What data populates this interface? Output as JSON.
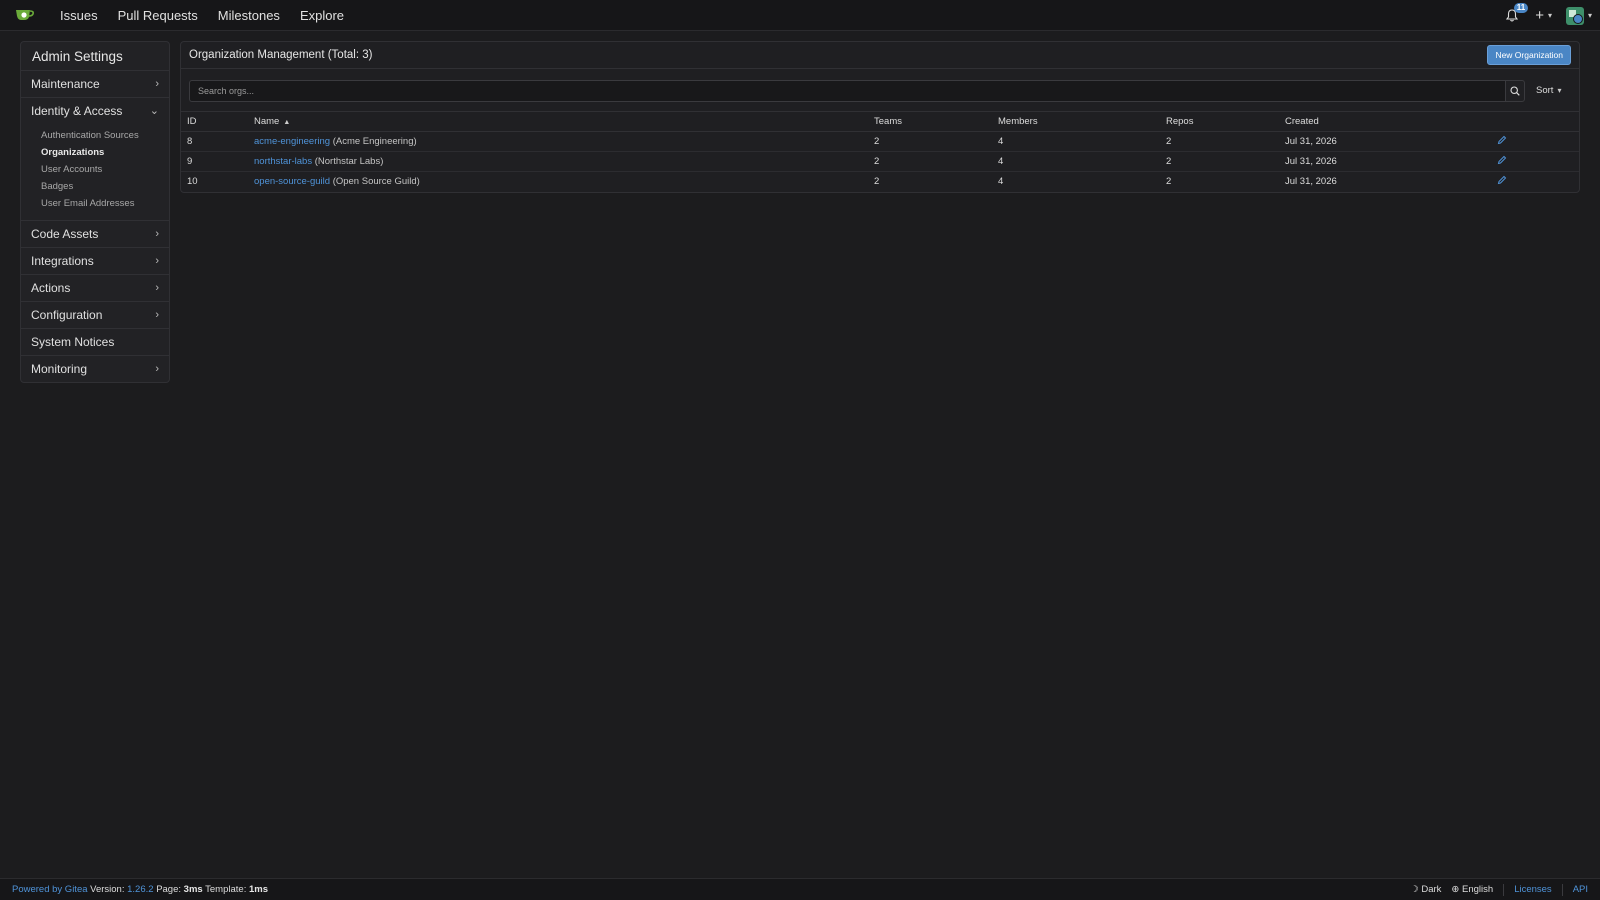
{
  "topnav": {
    "links": [
      "Issues",
      "Pull Requests",
      "Milestones",
      "Explore"
    ],
    "notifications_count": "11",
    "plus_symbol": "+"
  },
  "sidebar": {
    "title": "Admin Settings",
    "items": [
      {
        "label": "Maintenance",
        "expanded": false
      },
      {
        "label": "Identity & Access",
        "expanded": true,
        "subitems": [
          "Authentication Sources",
          "Organizations",
          "User Accounts",
          "Badges",
          "User Email Addresses"
        ],
        "active_subitem": "Organizations"
      },
      {
        "label": "Code Assets",
        "expanded": false
      },
      {
        "label": "Integrations",
        "expanded": false
      },
      {
        "label": "Actions",
        "expanded": false
      },
      {
        "label": "Configuration",
        "expanded": false
      },
      {
        "label": "System Notices"
      },
      {
        "label": "Monitoring",
        "expanded": false
      }
    ]
  },
  "main": {
    "title": "Organization Management (Total: 3)",
    "new_button": "New Organization",
    "search_placeholder": "Search orgs...",
    "sort_label": "Sort",
    "table": {
      "headers": [
        "ID",
        "Name",
        "Teams",
        "Members",
        "Repos",
        "Created"
      ],
      "rows": [
        {
          "id": "8",
          "name": "acme-engineering",
          "full_name": "(Acme Engineering)",
          "teams": "2",
          "members": "4",
          "repos": "2",
          "created": "Jul 31, 2026"
        },
        {
          "id": "9",
          "name": "northstar-labs",
          "full_name": "(Northstar Labs)",
          "teams": "2",
          "members": "4",
          "repos": "2",
          "created": "Jul 31, 2026"
        },
        {
          "id": "10",
          "name": "open-source-guild",
          "full_name": "(Open Source Guild)",
          "teams": "2",
          "members": "4",
          "repos": "2",
          "created": "Jul 31, 2026"
        }
      ]
    }
  },
  "footer": {
    "powered_by": "Powered by Gitea",
    "version_label": "Version:",
    "version": "1.26.2",
    "page_label": "Page:",
    "page_time": "3ms",
    "template_label": "Template:",
    "template_time": "1ms",
    "theme": "Dark",
    "language": "English",
    "licenses": "Licenses",
    "api": "API"
  },
  "colors": {
    "background": "#1c1c1e",
    "accent": "#4a86c5",
    "link": "#4f93d8"
  }
}
